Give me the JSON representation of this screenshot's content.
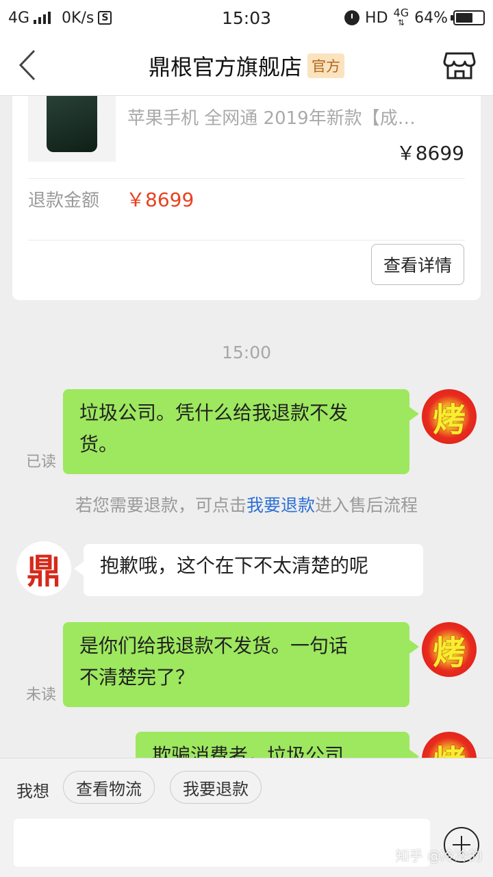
{
  "status_bar": {
    "network": "4G",
    "speed": "0K/s",
    "s_badge": "S",
    "time": "15:03",
    "hd": "HD",
    "network_right": "4G",
    "battery": "64%",
    "battery_level": 0.64
  },
  "nav": {
    "title": "鼎根官方旗舰店",
    "badge": "官方",
    "back_icon": "chevron-left-icon",
    "shop_icon": "storefront-icon"
  },
  "order_card": {
    "product_title": "苹果手机 全网通 2019年新款【成…",
    "product_price": "￥8699",
    "refund_label": "退款金额",
    "refund_value": "￥8699",
    "detail_button": "查看详情"
  },
  "timestamp": "15:00",
  "messages": [
    {
      "side": "out",
      "avatar_char": "烤",
      "lines": [
        "垃圾公司。凭什么给我退款不发",
        "货。"
      ],
      "status": "已读"
    },
    {
      "side": "in",
      "avatar_char": "鼎",
      "lines": [
        "抱歉哦，这个在下不太清楚的呢"
      ]
    },
    {
      "side": "out",
      "avatar_char": "烤",
      "lines": [
        "是你们给我退款不发货。一句话",
        "不清楚完了？"
      ],
      "status": "未读"
    },
    {
      "side": "out",
      "avatar_char": "烤",
      "lines": [
        "欺骗消费者，垃圾公司"
      ]
    }
  ],
  "system_tip": {
    "before": "若您需要退款，可点击",
    "link": "我要退款",
    "after": "进入售后流程"
  },
  "bottom": {
    "want_label": "我想",
    "quick_actions": [
      "查看物流",
      "我要退款"
    ],
    "input_value": "",
    "plus_icon": "plus-circle-icon"
  },
  "watermark": "知乎 @冷冷的"
}
